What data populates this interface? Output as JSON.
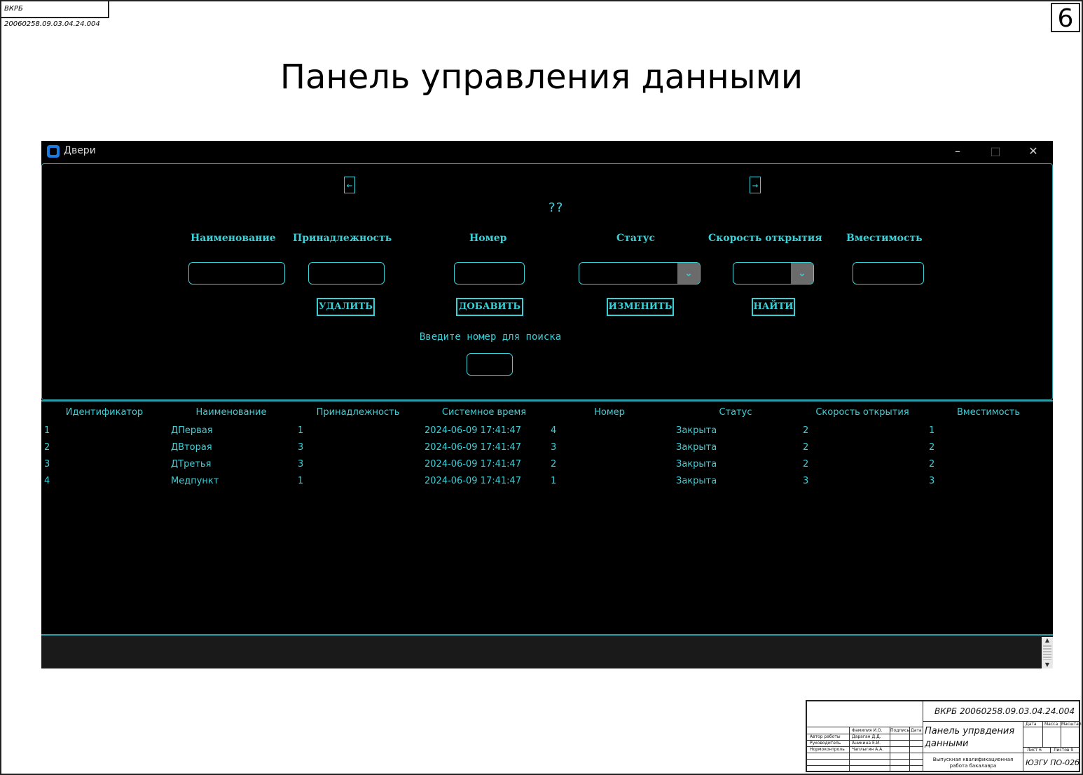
{
  "sheet": {
    "code_top": "ВКРБ 20060258.09.03.04.24.004",
    "page_number": "6",
    "title": "Панель управления данными"
  },
  "window": {
    "title": "Двери",
    "controls": {
      "minimize": "–",
      "maximize": "□",
      "close": "✕"
    }
  },
  "form": {
    "prev_label": "←",
    "next_label": "→",
    "page_indicator": "??",
    "labels": {
      "name": "Наименование",
      "belonging": "Принадлежность",
      "number": "Номер",
      "status": "Статус",
      "speed": "Скорость открытия",
      "capacity": "Вместимость"
    },
    "values": {
      "name": "",
      "belonging": "",
      "number": "",
      "status": "",
      "speed": "",
      "capacity": "",
      "search": ""
    },
    "buttons": {
      "delete": "УДАЛИТЬ",
      "add": "ДОБАВИТЬ",
      "edit": "ИЗМЕНИТЬ",
      "find": "НАЙТИ"
    },
    "search_label": "Введите номер для поиска"
  },
  "table": {
    "headers": [
      "Идентификатор",
      "Наименование",
      "Принадлежность",
      "Системное время",
      "Номер",
      "Статус",
      "Скорость открытия",
      "Вместимость"
    ],
    "rows": [
      [
        "1",
        "ДПервая",
        "1",
        "2024-06-09 17:41:47",
        "4",
        "Закрыта",
        "2",
        "1"
      ],
      [
        "2",
        "ДВторая",
        "3",
        "2024-06-09 17:41:47",
        "3",
        "Закрыта",
        "2",
        "2"
      ],
      [
        "3",
        "ДТретья",
        "3",
        "2024-06-09 17:41:47",
        "2",
        "Закрыта",
        "2",
        "2"
      ],
      [
        "4",
        "Медпункт",
        "1",
        "2024-06-09 17:41:47",
        "1",
        "Закрыта",
        "3",
        "3"
      ]
    ]
  },
  "title_block": {
    "code": "ВКРБ 20060258.09.03.04.24.004",
    "doc_title": "Панель упрвдения данными",
    "col_headers": [
      "Фамилия И.О.",
      "Подпись",
      "Дата"
    ],
    "roles": [
      "Автор работы",
      "Руководитель",
      "Нормоконтроль"
    ],
    "names": [
      "Дараган Д.Д.",
      "Аникина Е.И.",
      "Чаплыгин А.А."
    ],
    "meta_headers": [
      "Дата",
      "Масса",
      "Масштаб"
    ],
    "sheet_label": "Лист 6",
    "sheets_label": "Листов 9",
    "work_type": "Выпускная квалификационная работа бакалавра",
    "org": "ЮЗГУ ПО-02б"
  }
}
